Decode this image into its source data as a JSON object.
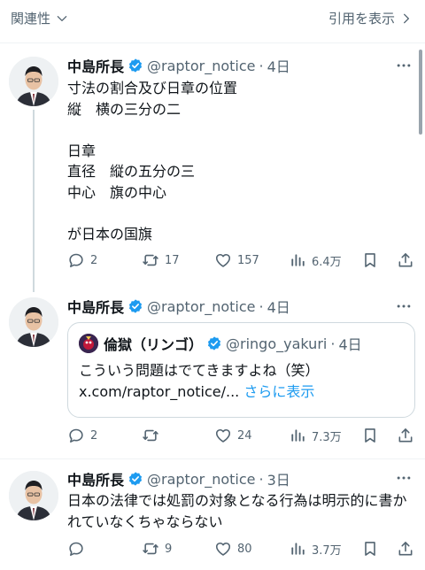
{
  "topbar": {
    "sort_label": "関連性",
    "quotes_label": "引用を表示"
  },
  "tweets": [
    {
      "name": "中島所長",
      "handle": "@raptor_notice",
      "time": "4日",
      "text": "寸法の割合及び日章の位置\n縦　横の三分の二\n\n日章\n直径　縦の五分の三\n中心　旗の中心\n\nが日本の国旗",
      "replies": "2",
      "reposts": "17",
      "likes": "157",
      "views": "6.4万"
    },
    {
      "name": "中島所長",
      "handle": "@raptor_notice",
      "time": "4日",
      "quote": {
        "name": "倫獄（リンゴ）",
        "handle": "@ringo_yakuri",
        "time": "4日",
        "text": "こういう問題はでてきますよね（笑） x.com/raptor_notice/... ",
        "more": "さらに表示"
      },
      "replies": "2",
      "reposts": "",
      "likes": "24",
      "views": "7.3万"
    },
    {
      "name": "中島所長",
      "handle": "@raptor_notice",
      "time": "3日",
      "text": "日本の法律では処罰の対象となる行為は明示的に書かれていなくちゃならない",
      "replies": "",
      "reposts": "9",
      "likes": "80",
      "views": "3.7万"
    }
  ],
  "colors": {
    "accent": "#1d9bf0",
    "muted": "#536471",
    "text": "#0f1419",
    "border": "#cfd9de"
  }
}
